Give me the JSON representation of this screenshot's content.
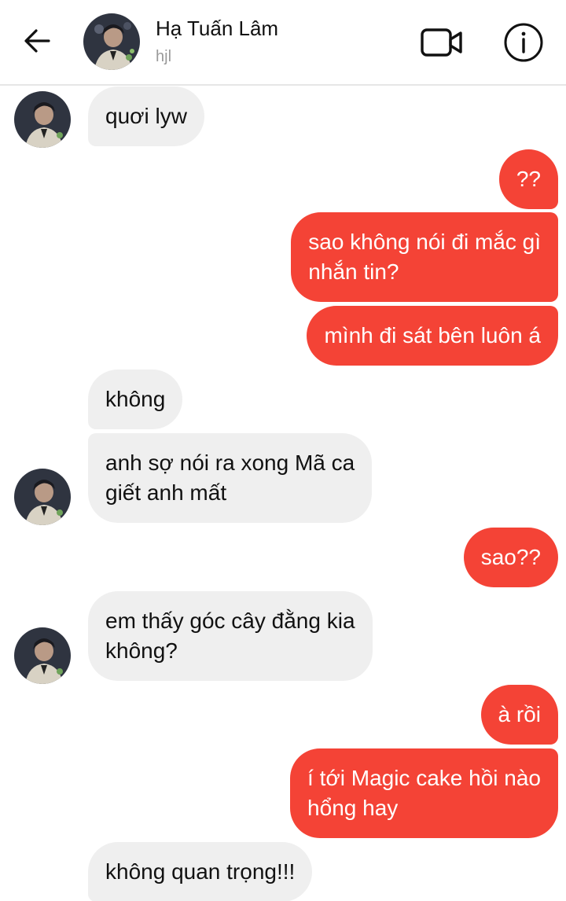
{
  "header": {
    "name": "Hạ Tuấn Lâm",
    "subtitle": "hjl"
  },
  "messages": [
    {
      "side": "in",
      "text": "quơi lyw"
    },
    {
      "side": "out",
      "text": "??"
    },
    {
      "side": "out",
      "lines": [
        "sao không nói đi mắc gì",
        "nhắn tin?"
      ]
    },
    {
      "side": "out",
      "text": "mình đi sát bên luôn á"
    },
    {
      "side": "in",
      "text": "không"
    },
    {
      "side": "in",
      "lines": [
        "anh sợ nói ra xong Mã ca",
        "giết anh mất"
      ]
    },
    {
      "side": "out",
      "text": "sao??"
    },
    {
      "side": "in",
      "lines": [
        "em thấy góc cây đằng kia",
        "không?"
      ]
    },
    {
      "side": "out",
      "text": "à rồi"
    },
    {
      "side": "out",
      "lines": [
        "í tới Magic cake hồi nào",
        "hổng hay"
      ]
    },
    {
      "side": "in",
      "text": "không quan trọng!!!"
    }
  ],
  "colors": {
    "outgoing": "#f44336",
    "incoming": "#efefef"
  },
  "icons": {
    "back": "arrow-left-icon",
    "video": "video-camera-icon",
    "info": "info-icon"
  }
}
